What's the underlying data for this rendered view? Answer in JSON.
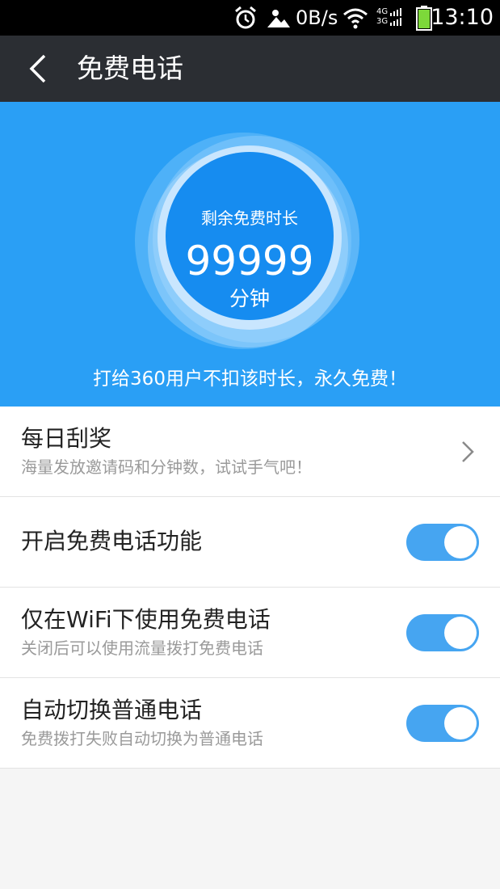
{
  "status_bar": {
    "net_speed": "0B/s",
    "signal_4g": "4G",
    "signal_3g": "3G",
    "time": "13:10",
    "icons": [
      "alarm-icon",
      "weather-icon",
      "wifi-icon",
      "cell-signal-icon",
      "battery-icon"
    ]
  },
  "header": {
    "title": "免费电话",
    "back_icon": "back-arrow-icon"
  },
  "hero": {
    "label": "剩余免费时长",
    "minutes": "99999",
    "unit": "分钟",
    "note": "打给360用户不扣该时长，永久免费！",
    "background_color": "#2a9ff5"
  },
  "settings": [
    {
      "title": "每日刮奖",
      "subtitle": "海量发放邀请码和分钟数，试试手气吧！",
      "control": "chevron"
    },
    {
      "title": "开启免费电话功能",
      "subtitle": "",
      "control": "toggle",
      "enabled": true
    },
    {
      "title": "仅在WiFi下使用免费电话",
      "subtitle": "关闭后可以使用流量拨打免费电话",
      "control": "toggle",
      "enabled": true
    },
    {
      "title": "自动切换普通电话",
      "subtitle": "免费拨打失败自动切换为普通电话",
      "control": "toggle",
      "enabled": true
    }
  ],
  "colors": {
    "accent": "#46a5f1",
    "header_bg": "#2b2e33"
  }
}
